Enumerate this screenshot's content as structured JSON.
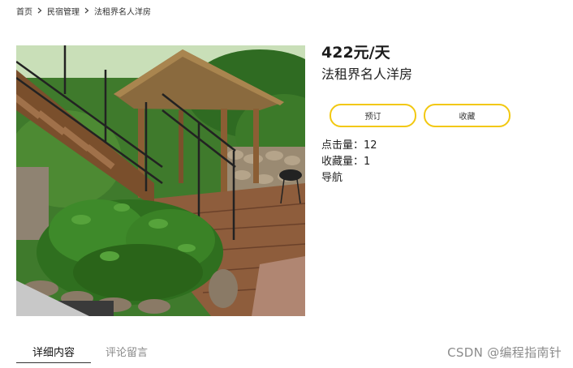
{
  "breadcrumb": {
    "items": [
      "首页",
      "民宿管理",
      "法租界名人洋房"
    ]
  },
  "listing": {
    "price": "422元/天",
    "title": "法租界名人洋房",
    "actions": {
      "book": "预订",
      "favorite": "收藏"
    },
    "stats": {
      "clicks": "点击量：12",
      "favorites": "收藏量：1",
      "nav": "导航"
    }
  },
  "tabs": {
    "details": "详细内容",
    "comments": "评论留言",
    "active": "details"
  },
  "watermark": "CSDN @编程指南针",
  "colors": {
    "accent_border": "#f2c811",
    "tab_active": "#111111",
    "tab_inactive": "#8a8a8a"
  }
}
